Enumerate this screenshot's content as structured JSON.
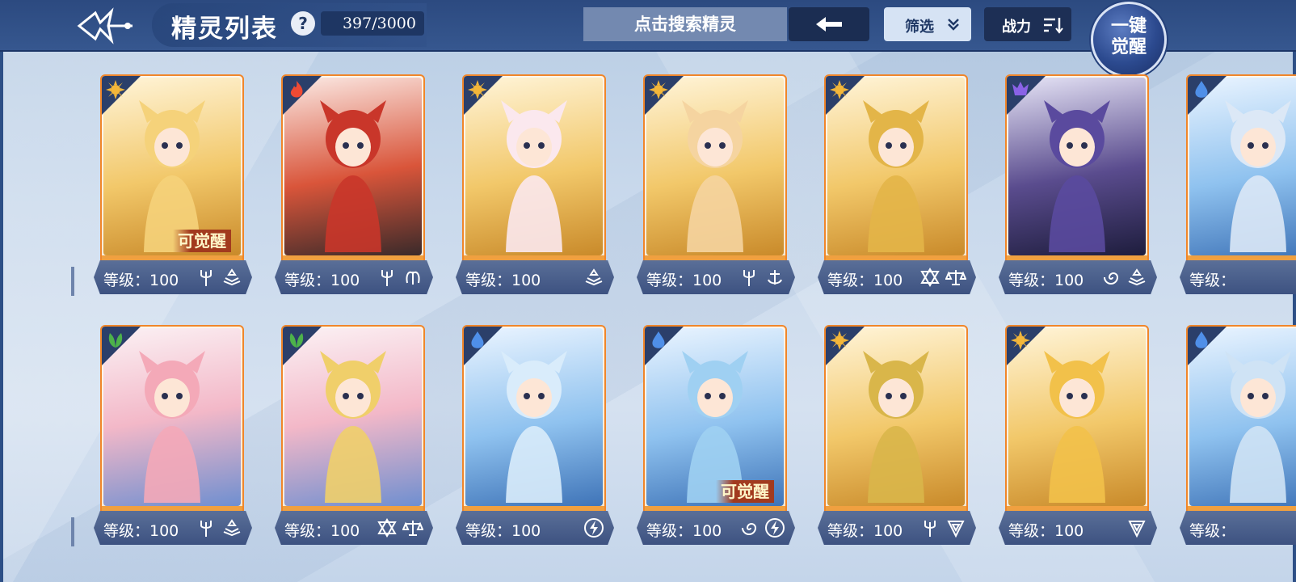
{
  "header": {
    "title": "精灵列表",
    "help_label": "?",
    "count_text": "397/3000",
    "search_placeholder": "点击搜索精灵",
    "filter_label": "筛选",
    "power_label": "战力",
    "awaken_line1": "一键",
    "awaken_line2": "觉醒"
  },
  "colors": {
    "card_border": "#f0862a",
    "bar": "#4a5f8c",
    "topbar": "#304f87"
  },
  "cards": [
    {
      "level_text": "等级：100",
      "element": "light",
      "badge": "可觉醒",
      "tags": [
        "trident-icon",
        "tome-icon"
      ]
    },
    {
      "level_text": "等级：100",
      "element": "fire",
      "badge": "",
      "tags": [
        "trident-icon",
        "wings-icon"
      ]
    },
    {
      "level_text": "等级：100",
      "element": "light",
      "badge": "",
      "tags": [
        "tome-icon"
      ]
    },
    {
      "level_text": "等级：100",
      "element": "light",
      "badge": "",
      "tags": [
        "trident-icon",
        "anchor-icon"
      ]
    },
    {
      "level_text": "等级：100",
      "element": "light",
      "badge": "",
      "tags": [
        "star-icon",
        "scale-icon"
      ]
    },
    {
      "level_text": "等级：100",
      "element": "shadow",
      "badge": "",
      "tags": [
        "swirl-icon",
        "tome-icon"
      ]
    },
    {
      "level_text": "等级：",
      "element": "water",
      "badge": "",
      "tags": []
    },
    {
      "level_text": "等级：100",
      "element": "grass",
      "badge": "",
      "tags": [
        "trident-icon",
        "tome-icon"
      ]
    },
    {
      "level_text": "等级：100",
      "element": "grass",
      "badge": "",
      "tags": [
        "star-icon",
        "scale-icon"
      ]
    },
    {
      "level_text": "等级：100",
      "element": "water",
      "badge": "",
      "tags": [
        "bolt-icon"
      ]
    },
    {
      "level_text": "等级：100",
      "element": "water",
      "badge": "可觉醒",
      "tags": [
        "swirl-icon",
        "bolt-icon"
      ]
    },
    {
      "level_text": "等级：100",
      "element": "light",
      "badge": "",
      "tags": [
        "trident-icon",
        "shield-icon"
      ]
    },
    {
      "level_text": "等级：100",
      "element": "light",
      "badge": "",
      "tags": [
        "shield-icon"
      ]
    },
    {
      "level_text": "等级：",
      "element": "water",
      "badge": "",
      "tags": []
    }
  ]
}
